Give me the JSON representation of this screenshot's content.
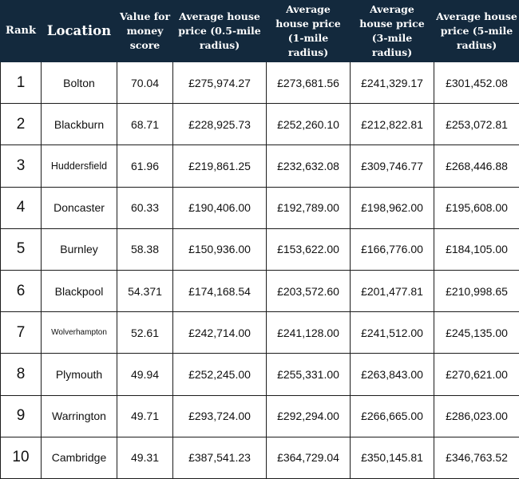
{
  "header": {
    "rank": "Rank",
    "location": "Location",
    "score": "Value for money score",
    "price_05": "Average house price (0.5-mile radius)",
    "price_1": "Average house price (1-mile radius)",
    "price_3": "Average house price (3-mile radius)",
    "price_5": "Average house price (5-mile radius)"
  },
  "rows": [
    {
      "rank": "1",
      "location": "Bolton",
      "score": "70.04",
      "p05": "£275,974.27",
      "p1": "£273,681.56",
      "p3": "£241,329.17",
      "p5": "£301,452.08"
    },
    {
      "rank": "2",
      "location": "Blackburn",
      "score": "68.71",
      "p05": "£228,925.73",
      "p1": "£252,260.10",
      "p3": "£212,822.81",
      "p5": "£253,072.81"
    },
    {
      "rank": "3",
      "location": "Huddersfield",
      "score": "61.96",
      "p05": "£219,861.25",
      "p1": "£232,632.08",
      "p3": "£309,746.77",
      "p5": "£268,446.88"
    },
    {
      "rank": "4",
      "location": "Doncaster",
      "score": "60.33",
      "p05": "£190,406.00",
      "p1": "£192,789.00",
      "p3": "£198,962.00",
      "p5": "£195,608.00"
    },
    {
      "rank": "5",
      "location": "Burnley",
      "score": "58.38",
      "p05": "£150,936.00",
      "p1": "£153,622.00",
      "p3": "£166,776.00",
      "p5": "£184,105.00"
    },
    {
      "rank": "6",
      "location": "Blackpool",
      "score": "54.371",
      "p05": "£174,168.54",
      "p1": "£203,572.60",
      "p3": "£201,477.81",
      "p5": "£210,998.65"
    },
    {
      "rank": "7",
      "location": "Wolverhampton",
      "score": "52.61",
      "p05": "£242,714.00",
      "p1": "£241,128.00",
      "p3": "£241,512.00",
      "p5": "£245,135.00"
    },
    {
      "rank": "8",
      "location": "Plymouth",
      "score": "49.94",
      "p05": "£252,245.00",
      "p1": "£255,331.00",
      "p3": "£263,843.00",
      "p5": "£270,621.00"
    },
    {
      "rank": "9",
      "location": "Warrington",
      "score": "49.71",
      "p05": "£293,724.00",
      "p1": "£292,294.00",
      "p3": "£266,665.00",
      "p5": "£286,023.00"
    },
    {
      "rank": "10",
      "location": "Cambridge",
      "score": "49.31",
      "p05": "£387,541.23",
      "p1": "£364,729.04",
      "p3": "£350,145.81",
      "p5": "£346,763.52"
    }
  ]
}
